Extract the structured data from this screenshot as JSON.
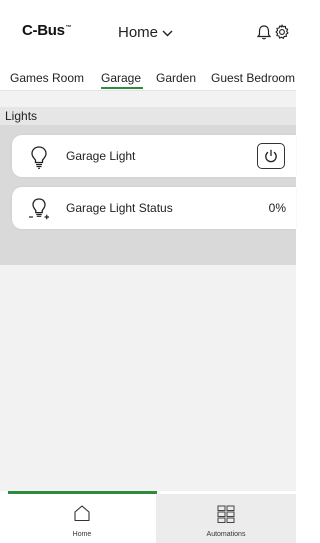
{
  "header": {
    "logo_text": "C-Bus",
    "logo_mark": "™",
    "location_label": "Home",
    "icons": [
      "bell-icon",
      "gear-icon"
    ]
  },
  "tabs": [
    {
      "label": "Games Room",
      "active": false
    },
    {
      "label": "Garage",
      "active": true
    },
    {
      "label": "Garden",
      "active": false
    },
    {
      "label": "Guest Bedroom",
      "active": false
    }
  ],
  "group": {
    "label": "Lights",
    "items": [
      {
        "label": "Garage Light",
        "icon": "light-bulb-icon",
        "control": "power-icon"
      },
      {
        "label": "Garage Light Status",
        "icon": "light-status-icon",
        "value": "0%"
      }
    ]
  },
  "bottom_nav": {
    "items": [
      {
        "label": "Home",
        "icon": "home-icon",
        "active": true
      },
      {
        "label": "Automations",
        "icon": "grid-icon",
        "active": false
      }
    ]
  },
  "colors": {
    "accent": "#2e8b3d",
    "background": "#f2f2f2",
    "group_panel": "#d9d9d9"
  }
}
